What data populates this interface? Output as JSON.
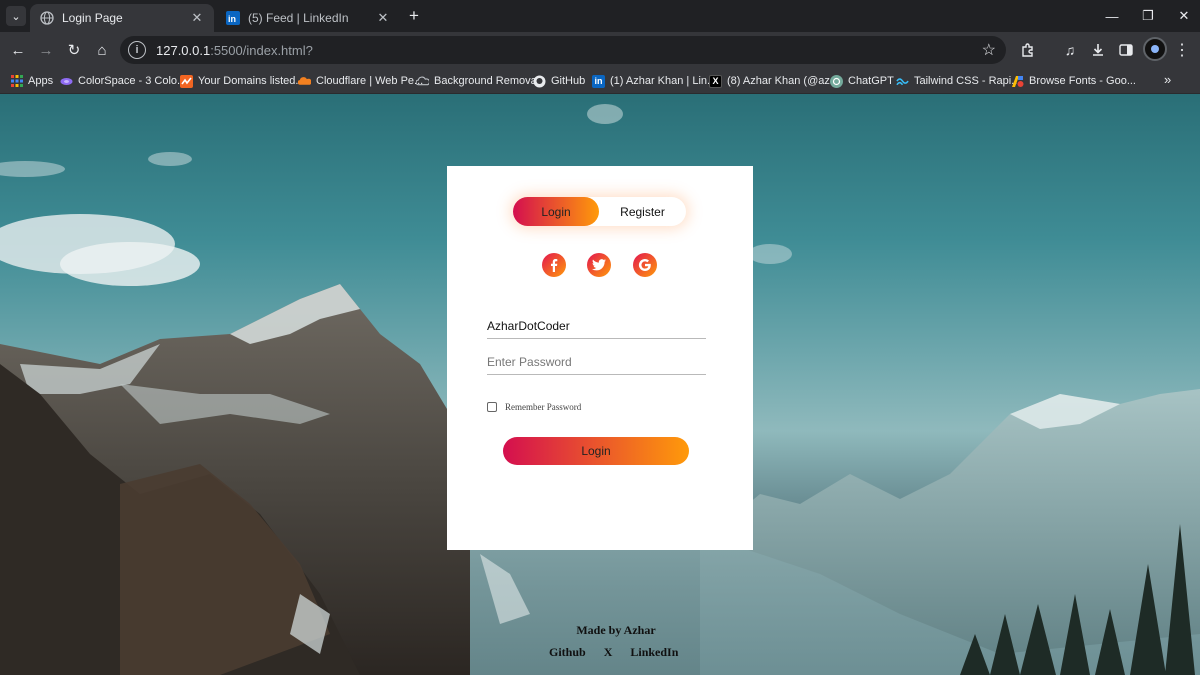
{
  "browser": {
    "tabs": [
      {
        "title": "Login Page",
        "active": true,
        "favicon": "globe-icon"
      },
      {
        "title": "(5) Feed | LinkedIn",
        "active": false,
        "favicon": "linkedin-icon"
      }
    ],
    "url": {
      "host": "127.0.0.1",
      "rest": ":5500/index.html?"
    },
    "bookmarks": [
      {
        "label": "Apps",
        "icon": "apps-grid-icon"
      },
      {
        "label": "ColorSpace - 3 Colo...",
        "icon": "colorspace-icon"
      },
      {
        "label": "Your Domains listed...",
        "icon": "domains-icon"
      },
      {
        "label": "Cloudflare | Web Pe...",
        "icon": "cloudflare-icon"
      },
      {
        "label": "Background Removal",
        "icon": "cloud-icon"
      },
      {
        "label": "GitHub",
        "icon": "github-icon"
      },
      {
        "label": "(1) Azhar Khan | Lin...",
        "icon": "linkedin-icon"
      },
      {
        "label": "(8) Azhar Khan (@az...",
        "icon": "x-icon"
      },
      {
        "label": "ChatGPT",
        "icon": "chatgpt-icon"
      },
      {
        "label": "Tailwind CSS - Rapi...",
        "icon": "tailwind-icon"
      },
      {
        "label": "Browse Fonts - Goo...",
        "icon": "google-fonts-icon"
      }
    ]
  },
  "login": {
    "toggle": {
      "login": "Login",
      "register": "Register"
    },
    "social": [
      {
        "name": "facebook",
        "glyph": "f"
      },
      {
        "name": "twitter",
        "glyph": "twitter-bird"
      },
      {
        "name": "google",
        "glyph": "G"
      }
    ],
    "username": {
      "value": "AzharDotCoder",
      "placeholder": ""
    },
    "password": {
      "value": "",
      "placeholder": "Enter Password"
    },
    "remember_label": "Remember Password",
    "submit_label": "Login"
  },
  "footer": {
    "credit": "Made by Azhar",
    "links": [
      "Github",
      "X",
      "LinkedIn"
    ]
  },
  "colors": {
    "gradient_start": "#d40f4f",
    "gradient_end": "#ff9a0a",
    "chrome_dark": "#202124",
    "chrome_toolbar": "#35363a"
  }
}
